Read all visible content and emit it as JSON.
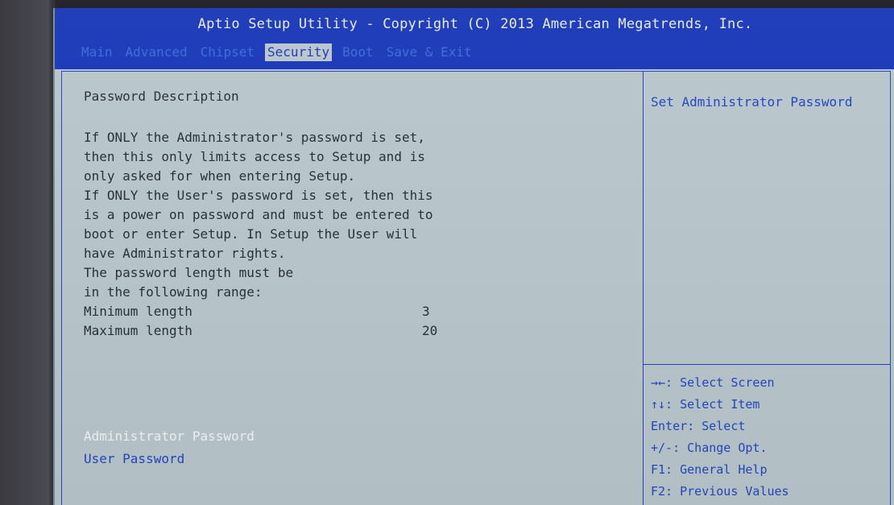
{
  "title": "Aptio Setup Utility - Copyright (C) 2013 American Megatrends, Inc.",
  "tabs": [
    {
      "label": "Main"
    },
    {
      "label": "Advanced"
    },
    {
      "label": "Chipset"
    },
    {
      "label": "Security",
      "active": true
    },
    {
      "label": "Boot"
    },
    {
      "label": "Save & Exit"
    }
  ],
  "main": {
    "section_title": "Password Description",
    "description_lines": [
      "If ONLY the Administrator's password is set,",
      "then this only limits access to Setup and is",
      "only asked for when entering Setup.",
      "If ONLY the User's password is set, then this",
      "is a power on password and must be entered to",
      "boot or enter Setup. In Setup the User will",
      "have Administrator rights.",
      "The password length must be",
      "in the following range:"
    ],
    "min_length": {
      "label": "Minimum length",
      "value": "3"
    },
    "max_length": {
      "label": "Maximum length",
      "value": "20"
    },
    "menu": [
      {
        "label": "Administrator Password",
        "selected": true
      },
      {
        "label": "User Password",
        "selected": false
      }
    ]
  },
  "help": {
    "text": "Set Administrator Password"
  },
  "keys": [
    "→←: Select Screen",
    "↑↓: Select Item",
    "Enter: Select",
    "+/-: Change Opt.",
    "F1: General Help",
    "F2: Previous Values"
  ],
  "colors": {
    "title_bar": "#1a38b8",
    "background": "#b8c6cc",
    "accent_text": "#2446bf",
    "selected_text": "#f1f4f6"
  }
}
